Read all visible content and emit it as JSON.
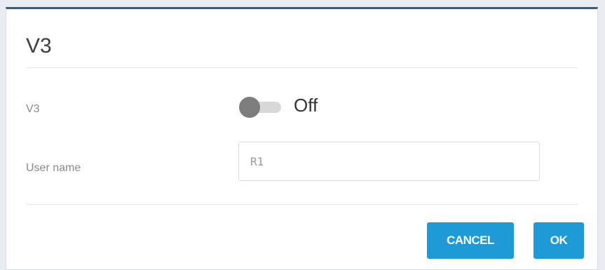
{
  "dialog": {
    "title": "V3",
    "fields": {
      "v3": {
        "label": "V3",
        "toggle_state": "Off",
        "enabled": false
      },
      "user_name": {
        "label": "User name",
        "value": "R1"
      }
    },
    "buttons": {
      "cancel": "CANCEL",
      "ok": "OK"
    }
  },
  "colors": {
    "accent": "#1e9bd7",
    "header_border": "#3c5a78",
    "toggle_knob_off": "#7d7d7d",
    "toggle_track_off": "#d8d8d8"
  }
}
